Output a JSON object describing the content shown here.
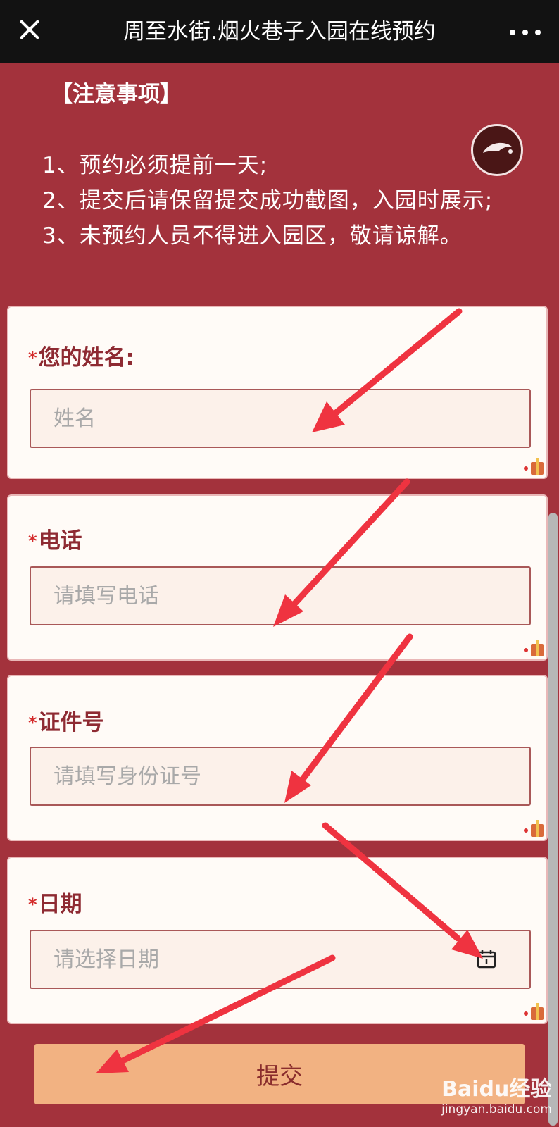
{
  "header": {
    "title": "周至水街.烟火巷子入园在线预约",
    "close_icon": "close-icon",
    "more_icon": "more-icon"
  },
  "notice": {
    "heading": "【注意事项】",
    "items": [
      "1、预约必须提前一天;",
      "2、提交后请保留提交成功截图，入园时展示;",
      "3、未预约人员不得进入园区，敬请谅解。"
    ]
  },
  "music_icon": "music-icon",
  "form": {
    "required_mark": "*",
    "name": {
      "label": "您的姓名:",
      "placeholder": "姓名"
    },
    "phone": {
      "label": "电话",
      "placeholder": "请填写电话"
    },
    "id_number": {
      "label": "证件号",
      "placeholder": "请填写身份证号"
    },
    "date": {
      "label": "日期",
      "placeholder": "请选择日期",
      "icon": "calendar-icon"
    },
    "submit_label": "提交"
  },
  "watermark": {
    "logo": "Baidu经验",
    "site": "jingyan.baidu.com"
  },
  "colors": {
    "page_background": "#a3323c",
    "topbar": "#121212",
    "card_background": "#fffbf7",
    "field_background": "#fcf1ea",
    "field_border": "#a95858",
    "label_text": "#8e2a32",
    "required_star": "#d42b2b",
    "submit_background": "#f2b282",
    "submit_text": "#8a2d2d",
    "annotation_arrow": "#ef3340"
  }
}
